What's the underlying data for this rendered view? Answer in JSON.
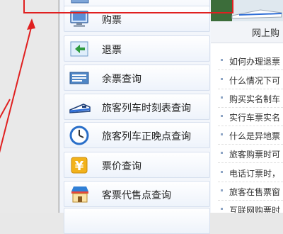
{
  "menu": {
    "items": [
      {
        "label": "购票",
        "icon": "computer-ticket-icon"
      },
      {
        "label": "退票",
        "icon": "return-arrow-icon"
      },
      {
        "label": "余票查询",
        "icon": "ticket-list-icon"
      },
      {
        "label": "旅客列车时刻表查询",
        "icon": "train-icon"
      },
      {
        "label": "旅客列车正晚点查询",
        "icon": "clock-icon"
      },
      {
        "label": "票价查询",
        "icon": "yuan-price-icon"
      },
      {
        "label": "客票代售点查询",
        "icon": "shop-icon"
      }
    ]
  },
  "panel": {
    "title": "网上购"
  },
  "faq": {
    "items": [
      "如何办理退票",
      "什么情况下可",
      "购买实名制车",
      "实行车票实名",
      "什么是异地票",
      "旅客购票时可",
      "电话订票时，",
      "旅客在售票窗",
      "互联网购票时"
    ]
  },
  "colors": {
    "annotation_red": "#e02020",
    "menu_bg": "#f3f6fb",
    "item_border": "#d6dfee"
  }
}
